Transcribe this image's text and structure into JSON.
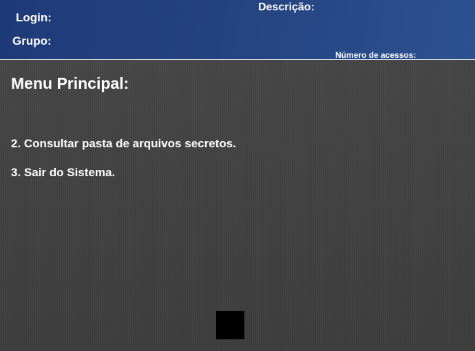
{
  "header": {
    "login_label": "Login:",
    "group_label": "Grupo:",
    "description_label": "Descrição:",
    "access_count_label": "Número de acessos:"
  },
  "menu": {
    "title": "Menu Principal:",
    "items": [
      {
        "label": "2. Consultar pasta de arquivos secretos."
      },
      {
        "label": "3. Sair do Sistema."
      }
    ]
  },
  "colors": {
    "header_bg": "#24427f",
    "body_bg": "#404040",
    "text": "#ffffff"
  }
}
